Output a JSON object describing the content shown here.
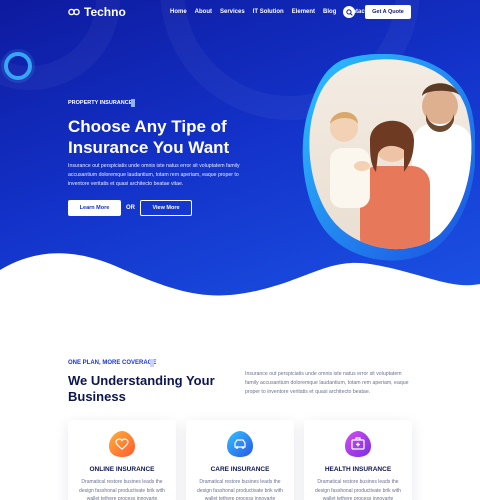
{
  "brand": {
    "name": "Techno"
  },
  "nav": {
    "items": [
      {
        "label": "Home"
      },
      {
        "label": "About"
      },
      {
        "label": "Services"
      },
      {
        "label": "IT Solution"
      },
      {
        "label": "Element"
      },
      {
        "label": "Blog"
      },
      {
        "label": "Contact"
      }
    ],
    "quote_label": "Get A Quote",
    "search_icon": "search-icon"
  },
  "hero": {
    "eyebrow": "PROPERTY INSURANCE",
    "title": "Choose Any Tipe of Insurance You Want",
    "description": "Insurance out perspiciatis unde omnis iste natus error sit voluptatem family accusantium doloremque laudantium, totam rem aperiam, eaque proper to inventore veritatis et quasi architecto beatae vitae.",
    "learn_label": "Learn More",
    "or_label": "OR",
    "view_label": "View More"
  },
  "plans": {
    "eyebrow": "ONE PLAN, MORE COVERAGE",
    "title": "We Understanding Your Business",
    "description": "Insurance out perspiciatis unde omnis iste natus error sit voluptatem family accusantium doloremque laudantium, totam rem aperiam, eaque proper to inventore veritatis et quasi architecto beatae.",
    "cards": [
      {
        "title": "ONLINE INSURANCE",
        "description": "Dramatical restore busines leads the design fasshonal productivate brik with wallet tethere process innovarte",
        "icon": "heart-shield-icon"
      },
      {
        "title": "CARE INSURANCE",
        "description": "Dramatical restore busines leads the design fasshonal productivate brik with wallet tethere process innovarte",
        "icon": "car-shield-icon"
      },
      {
        "title": "HEALTH INSURANCE",
        "description": "Dramatical restore busines leads the design fasshonal productivate brik with wallet tethere process innovarte",
        "icon": "medical-kit-icon"
      }
    ]
  },
  "colors": {
    "hero_start": "#0e1a9e",
    "hero_end": "#1c56e8",
    "accent": "#1a35d8",
    "title_dark": "#0c1552"
  }
}
